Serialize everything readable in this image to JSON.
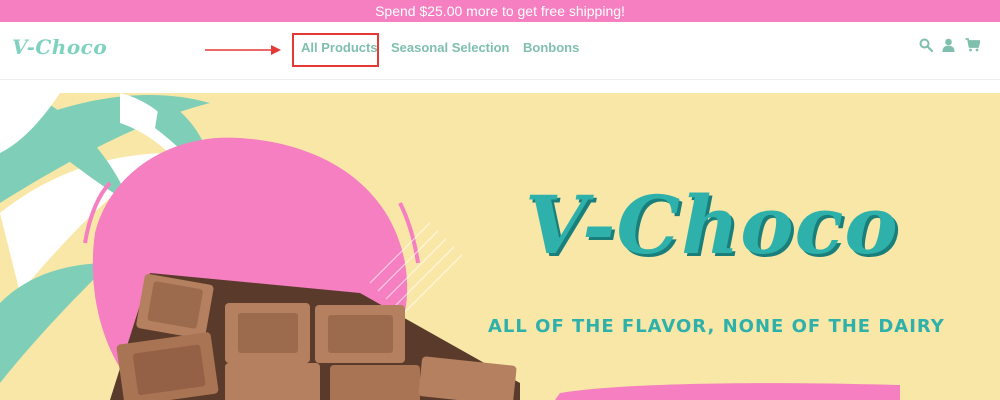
{
  "announcement": {
    "text": "Spend $25.00 more to get free shipping!"
  },
  "header": {
    "logo": "V-Choco",
    "nav": [
      {
        "label": "All Products"
      },
      {
        "label": "Seasonal Selection"
      },
      {
        "label": "Bonbons"
      }
    ],
    "icons": [
      "search-icon",
      "account-icon",
      "cart-icon"
    ]
  },
  "hero": {
    "title": "V-Choco",
    "subtitle": "ALL OF THE FLAVOR, NONE OF THE DAIRY"
  },
  "colors": {
    "announcement_bg": "#f57fc0",
    "brand_teal": "#2fb1ab",
    "nav_text": "#7fbfad",
    "hero_bg": "#f9e7a8",
    "pink_splash": "#f57fc0",
    "annotation_red": "#e53935"
  }
}
